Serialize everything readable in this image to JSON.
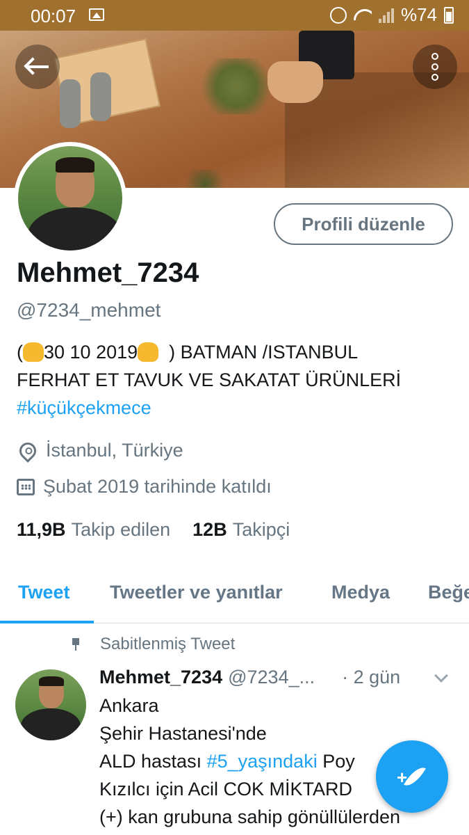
{
  "status_bar": {
    "time": "00:07",
    "battery": "%74"
  },
  "profile": {
    "display_name": "Mehmet_7234",
    "handle": "@7234_mehmet",
    "edit_button": "Profili düzenle",
    "bio_open": "(",
    "bio_date": "30 10 2019",
    "bio_close": ") BATMAN /ISTANBUL",
    "bio_line2": "FERHAT ET TAVUK VE SAKATAT ÜRÜNLERİ",
    "bio_hashtag": "#küçükçekmece",
    "location": "İstanbul, Türkiye",
    "joined": "Şubat 2019 tarihinde katıldı",
    "following_count": "11,9B",
    "following_label": "Takip edilen",
    "followers_count": "12B",
    "followers_label": "Takipçi"
  },
  "tabs": [
    {
      "label": "Tweet",
      "active": true
    },
    {
      "label": "Tweetler ve yanıtlar",
      "active": false
    },
    {
      "label": "Medya",
      "active": false
    },
    {
      "label": "Beğe",
      "active": false
    }
  ],
  "pinned_tweet": {
    "pinned_label": "Sabitlenmiş Tweet",
    "author_name": "Mehmet_7234",
    "author_handle": "@7234_...",
    "time": "· 2 gün",
    "line1": "Ankara",
    "line2": "Şehir Hastanesi'nde",
    "line3_pre": "ALD hastası ",
    "line3_hashtag": "#5_yaşındaki",
    "line3_post": " Poy",
    "line4": "Kızılcı için Acil COK MİKTARD",
    "line5": "(+) kan grubuna sahip gönüllülerden"
  },
  "colors": {
    "accent": "#1da1f2",
    "status_bar": "#a0702f",
    "secondary_text": "#66757f"
  },
  "icons": {
    "back": "arrow-left-icon",
    "more": "vertical-dots-icon",
    "location": "location-pin-icon",
    "calendar": "calendar-icon",
    "pin": "pushpin-icon",
    "compose": "quill-plus-icon"
  }
}
